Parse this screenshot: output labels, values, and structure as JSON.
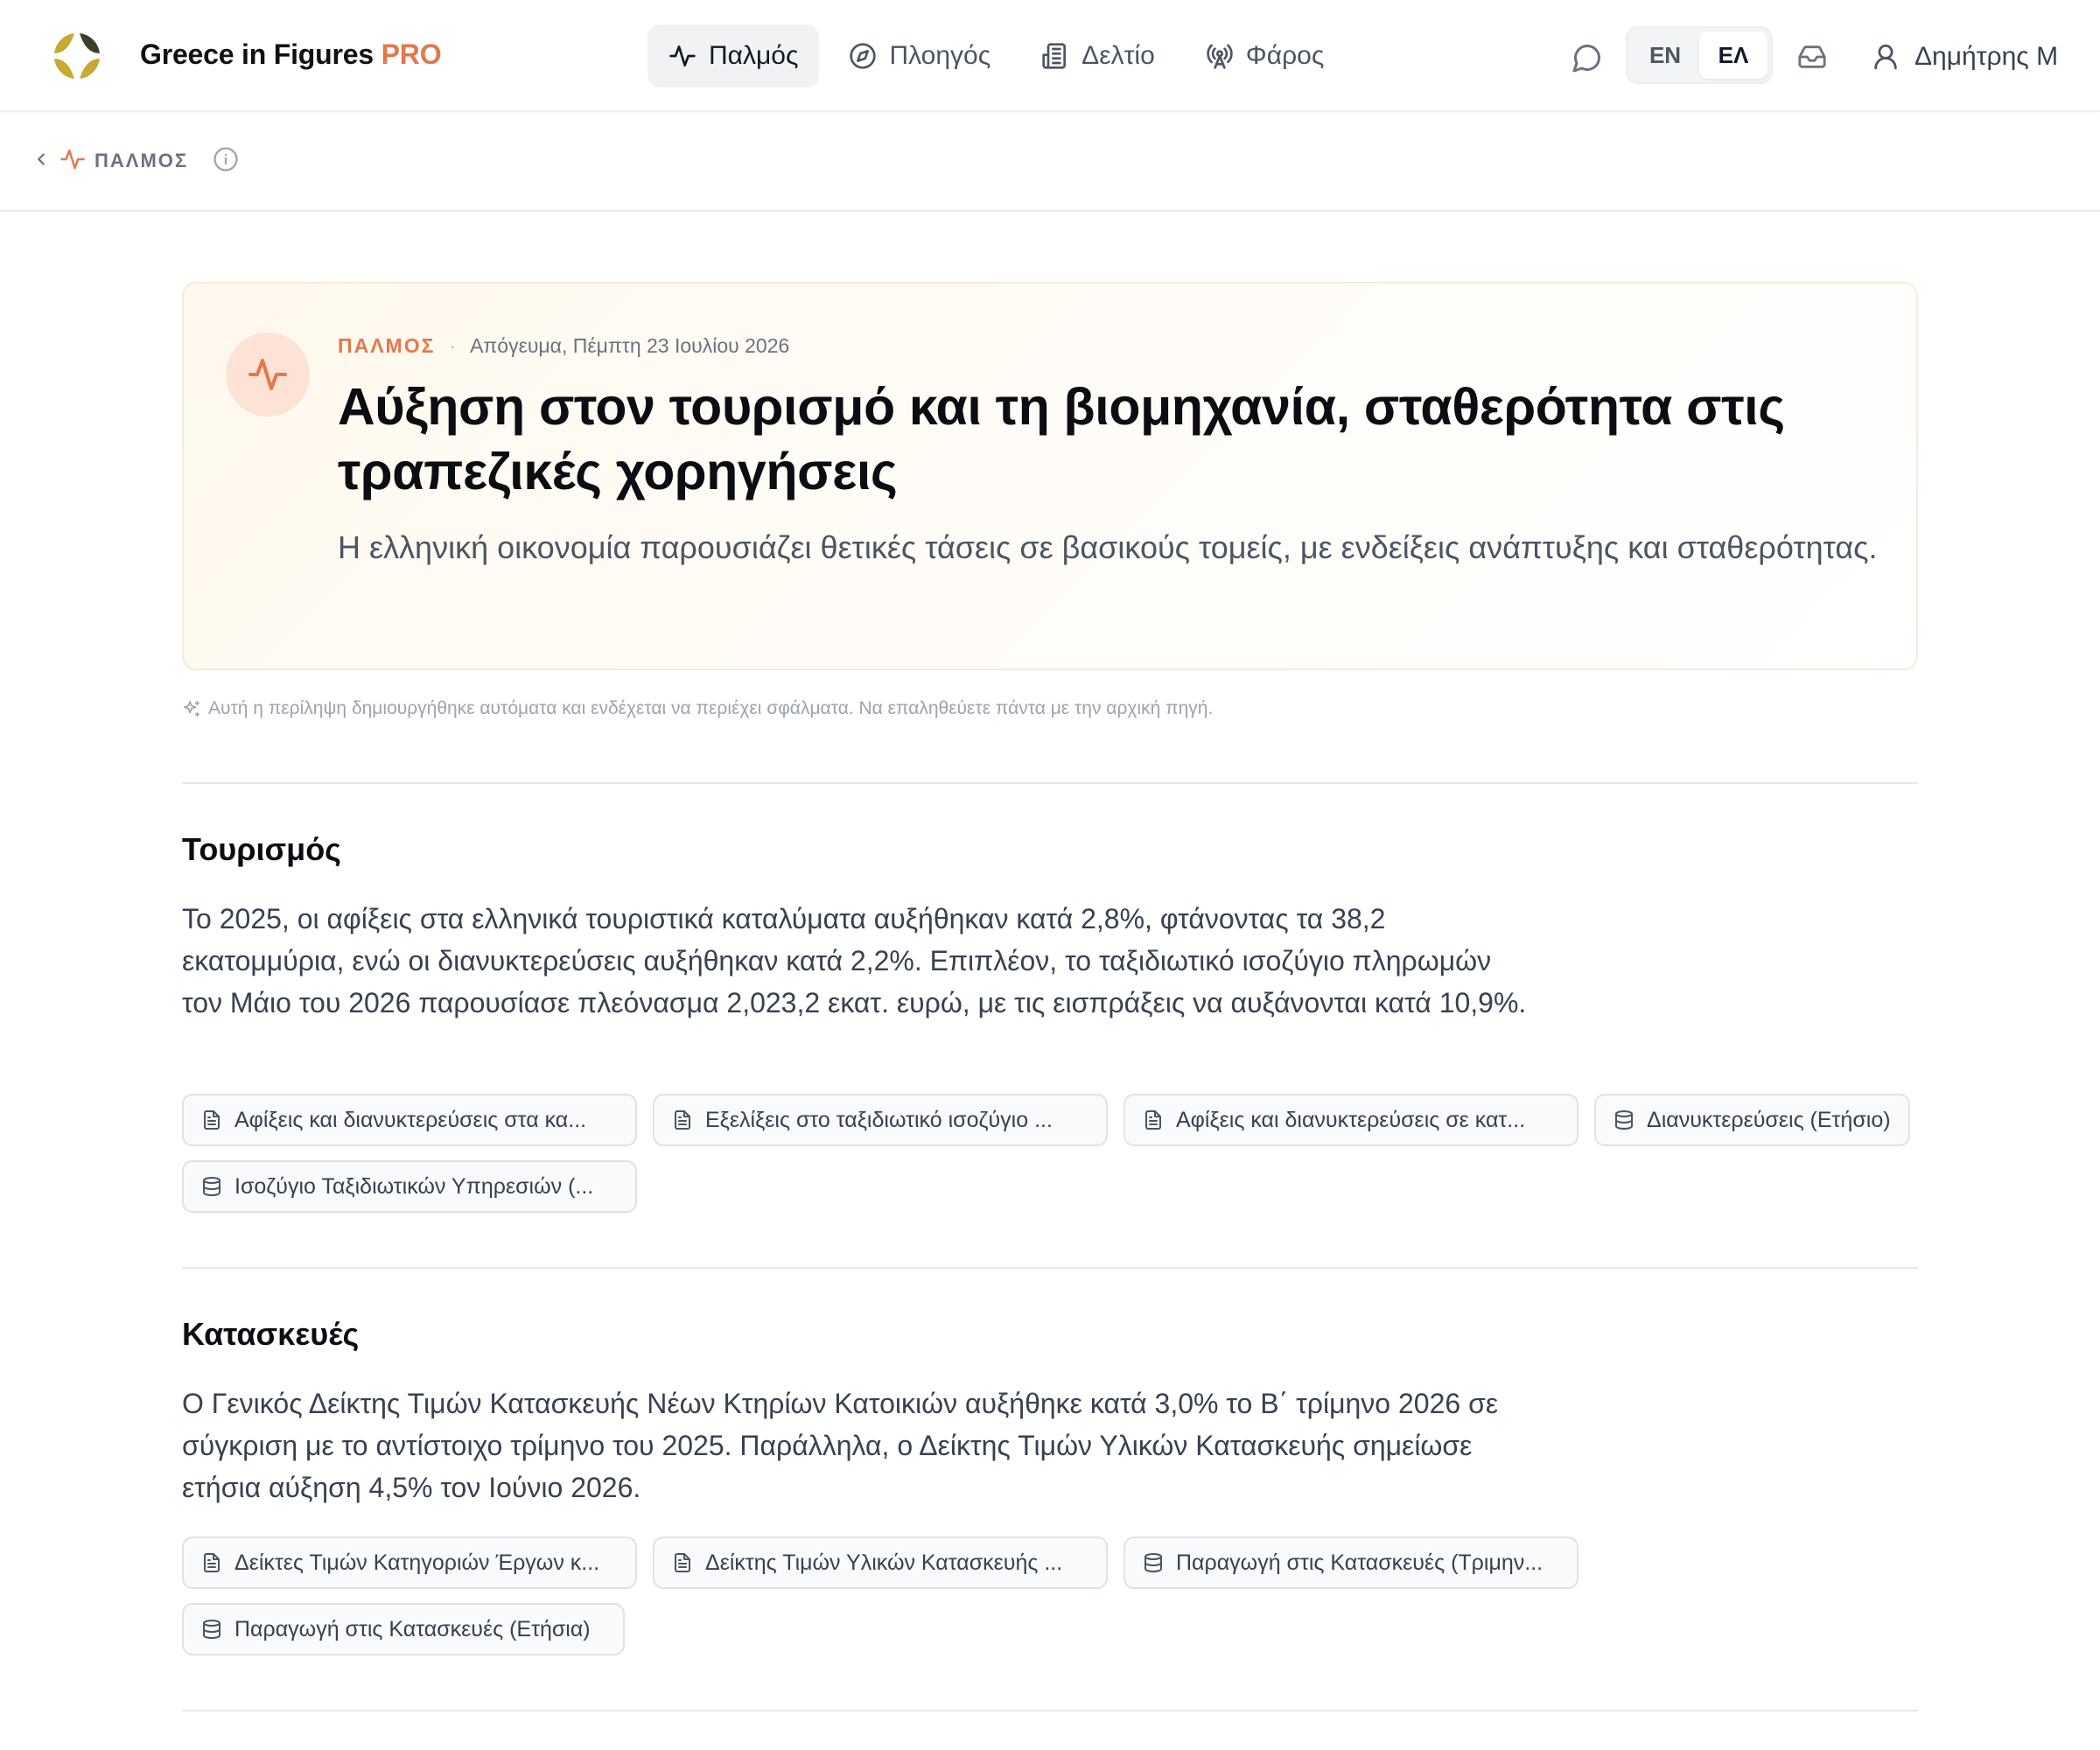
{
  "brand": {
    "name": "Greece in Figures",
    "tier": "PRO"
  },
  "nav": {
    "items": [
      {
        "label": "Παλμός",
        "icon": "pulse-icon",
        "active": true
      },
      {
        "label": "Πλοηγός",
        "icon": "compass-icon"
      },
      {
        "label": "Δελτίο",
        "icon": "newspaper-icon"
      },
      {
        "label": "Φάρος",
        "icon": "broadcast-icon"
      }
    ]
  },
  "header": {
    "lang_en": "EN",
    "lang_el": "ΕΛ",
    "active_lang": "ΕΛ",
    "user_name": "Δημήτρης Μ"
  },
  "breadcrumb": {
    "label": "ΠΑΛΜΟΣ"
  },
  "hero": {
    "tag": "ΠΑΛΜΟΣ",
    "separator": "·",
    "date": "Απόγευμα, Πέμπτη 23 Ιουλίου 2026",
    "title": "Αύξηση στον τουρισμό και τη βιομηχανία, σταθερότητα στις τραπεζικές χορηγήσεις",
    "subtitle": "Η ελληνική οικονομία παρουσιάζει θετικές τάσεις σε βασικούς τομείς, με ενδείξεις ανάπτυξης και σταθερότητας."
  },
  "disclaimer": "Αυτή η περίληψη δημιουργήθηκε αυτόματα και ενδέχεται να περιέχει σφάλματα. Να επαληθεύετε πάντα με την αρχική πηγή.",
  "sections": [
    {
      "title": "Τουρισμός",
      "body": "Το 2025, οι αφίξεις στα ελληνικά τουριστικά καταλύματα αυξήθηκαν κατά 2,8%, φτάνοντας τα 38,2 εκατομμύρια, ενώ οι διανυκτερεύσεις αυξήθηκαν κατά 2,2%. Επιπλέον, το ταξιδιωτικό ισοζύγιο πληρωμών τον Μάιο του 2026 παρουσίασε πλεόνασμα 2,023,2 εκατ. ευρώ, με τις εισπράξεις να αυξάνονται κατά 10,9%.",
      "sources": [
        {
          "type": "document",
          "label": "Αφίξεις και διανυκτερεύσεις στα κα..."
        },
        {
          "type": "document",
          "label": "Εξελίξεις στο ταξιδιωτικό ισοζύγιο ..."
        },
        {
          "type": "document",
          "label": "Αφίξεις και διανυκτερεύσεις σε κατ..."
        },
        {
          "type": "dataset",
          "label": "Διανυκτερεύσεις (Ετήσιο)"
        },
        {
          "type": "dataset",
          "label": "Ισοζύγιο Ταξιδιωτικών Υπηρεσιών (..."
        }
      ]
    },
    {
      "title": "Κατασκευές",
      "body": "Ο Γενικός Δείκτης Τιμών Κατασκευής Νέων Κτηρίων Κατοικιών αυξήθηκε κατά 3,0% το Β΄ τρίμηνο 2026 σε σύγκριση με το αντίστοιχο τρίμηνο του 2025. Παράλληλα, ο Δείκτης Τιμών Υλικών Κατασκευής σημείωσε ετήσια αύξηση 4,5% τον Ιούνιο 2026.",
      "sources": [
        {
          "type": "document",
          "label": "Δείκτες Τιμών Κατηγοριών Έργων κ..."
        },
        {
          "type": "document",
          "label": "Δείκτης Τιμών Υλικών Κατασκευής ..."
        },
        {
          "type": "dataset",
          "label": "Παραγωγή στις Κατασκευές (Τριμην..."
        },
        {
          "type": "dataset",
          "label": "Παραγωγή στις Κατασκευές (Ετήσια)"
        }
      ]
    }
  ],
  "colors": {
    "accent": "#e4784d",
    "logo_gold": "#c8a932"
  }
}
